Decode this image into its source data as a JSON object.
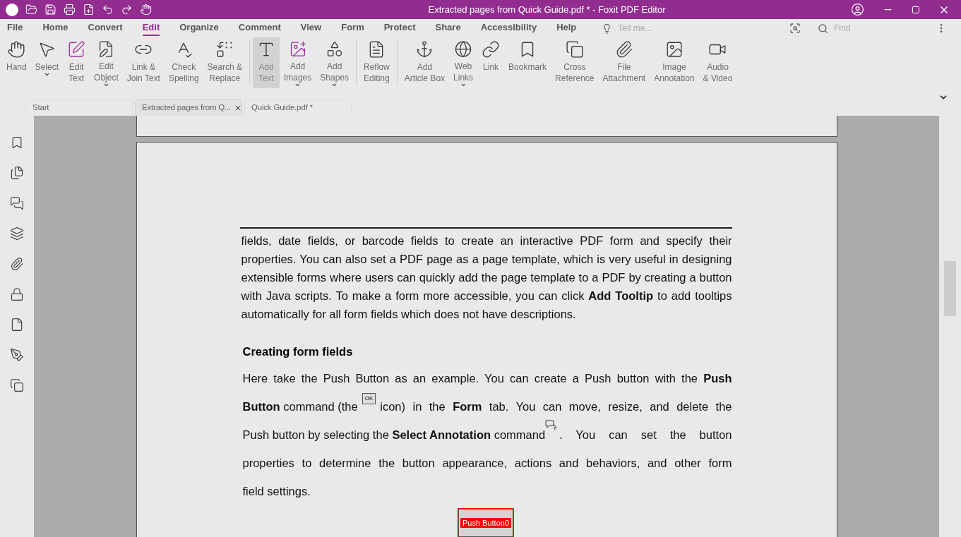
{
  "window": {
    "title": "Extracted pages from Quick Guide.pdf * - Foxit PDF Editor"
  },
  "menu_tabs": [
    {
      "label": "File",
      "selected": false
    },
    {
      "label": "Home",
      "selected": false
    },
    {
      "label": "Convert",
      "selected": false
    },
    {
      "label": "Edit",
      "selected": true
    },
    {
      "label": "Organize",
      "selected": false
    },
    {
      "label": "Comment",
      "selected": false
    },
    {
      "label": "View",
      "selected": false
    },
    {
      "label": "Form",
      "selected": false
    },
    {
      "label": "Protect",
      "selected": false
    },
    {
      "label": "Share",
      "selected": false
    },
    {
      "label": "Accessibility",
      "selected": false
    },
    {
      "label": "Help",
      "selected": false
    }
  ],
  "tell_me": {
    "placeholder": "Tell me..."
  },
  "find": {
    "placeholder": "Find"
  },
  "ribbon_groups": [
    [
      {
        "kind": "hand",
        "label": [
          "Hand"
        ],
        "dropdown": false,
        "selected": false
      },
      {
        "kind": "select",
        "label": [
          "Select"
        ],
        "dropdown": true,
        "selected": false
      },
      {
        "kind": "edit-text",
        "label": [
          "Edit",
          "Text"
        ],
        "dropdown": false,
        "selected": false
      },
      {
        "kind": "edit-object",
        "label": [
          "Edit",
          "Object"
        ],
        "dropdown": true,
        "selected": false
      },
      {
        "kind": "link-join",
        "label": [
          "Link &",
          "Join Text"
        ],
        "dropdown": false,
        "selected": false
      },
      {
        "kind": "spelling",
        "label": [
          "Check",
          "Spelling"
        ],
        "dropdown": false,
        "selected": false
      },
      {
        "kind": "replace",
        "label": [
          "Search &",
          "Replace"
        ],
        "dropdown": false,
        "selected": false
      }
    ],
    [
      {
        "kind": "add-text",
        "label": [
          "Add",
          "Text"
        ],
        "dropdown": false,
        "selected": true
      },
      {
        "kind": "add-image",
        "label": [
          "Add",
          "Images"
        ],
        "dropdown": true,
        "selected": false
      },
      {
        "kind": "add-shape",
        "label": [
          "Add",
          "Shapes"
        ],
        "dropdown": true,
        "selected": false
      }
    ],
    [
      {
        "kind": "reflow",
        "label": [
          "Reflow",
          "Editing"
        ],
        "dropdown": false,
        "selected": false
      }
    ],
    [
      {
        "kind": "article",
        "label": [
          "Add",
          "Article Box"
        ],
        "dropdown": false,
        "selected": false
      },
      {
        "kind": "web",
        "label": [
          "Web",
          "Links"
        ],
        "dropdown": true,
        "selected": false
      },
      {
        "kind": "link",
        "label": [
          "Link"
        ],
        "dropdown": false,
        "selected": false
      },
      {
        "kind": "bookmark",
        "label": [
          "Bookmark"
        ],
        "dropdown": false,
        "selected": false
      },
      {
        "kind": "cross",
        "label": [
          "Cross",
          "Reference"
        ],
        "dropdown": false,
        "selected": false
      },
      {
        "kind": "attach",
        "label": [
          "File",
          "Attachment"
        ],
        "dropdown": false,
        "selected": false
      },
      {
        "kind": "image-note",
        "label": [
          "Image",
          "Annotation"
        ],
        "dropdown": false,
        "selected": false
      },
      {
        "kind": "video",
        "label": [
          "Audio",
          "& Video"
        ],
        "dropdown": false,
        "selected": false
      }
    ]
  ],
  "doc_tabs": [
    {
      "label": "Start",
      "selected": false,
      "closable": false
    },
    {
      "label": "Extracted pages from Q...",
      "selected": true,
      "closable": true
    },
    {
      "label": "Quick Guide.pdf *",
      "selected": false,
      "closable": false
    }
  ],
  "document": {
    "paragraph_1": "fields, date fields, or barcode fields to create an interactive PDF form and specify their properties. You can also set a PDF page as a page template, which is very useful in designing extensible forms where users can quickly add the page template to a PDF by creating a button with Java scripts. To make a form more accessible, you can click **Add Tooltip** to add tooltips automatically for all form fields which does not have descriptions.",
    "heading": "Creating form fields",
    "paragraph_2": [
      [
        {
          "kind": "text",
          "text": "Here take the Push Button as an example. You can create a Push button with the **Push**"
        }
      ],
      [
        {
          "kind": "text",
          "text": "**Button** command (the"
        },
        {
          "kind": "ok-icon",
          "text": "OK"
        },
        {
          "kind": "text",
          "text": "icon) in the **Form** tab. You can move, resize, and delete the"
        }
      ],
      [
        {
          "kind": "text",
          "text": "Push button by selecting the **Select Annotation** command"
        },
        {
          "kind": "annot-icon"
        },
        {
          "kind": "text",
          "text": ". You can set the button"
        }
      ],
      [
        {
          "kind": "text",
          "text": "properties to determine the button appearance, actions and behaviors, and other form"
        }
      ],
      [
        {
          "kind": "text",
          "text": "field settings."
        }
      ]
    ],
    "push_button": {
      "label": "Push Button0",
      "selected": true
    }
  }
}
